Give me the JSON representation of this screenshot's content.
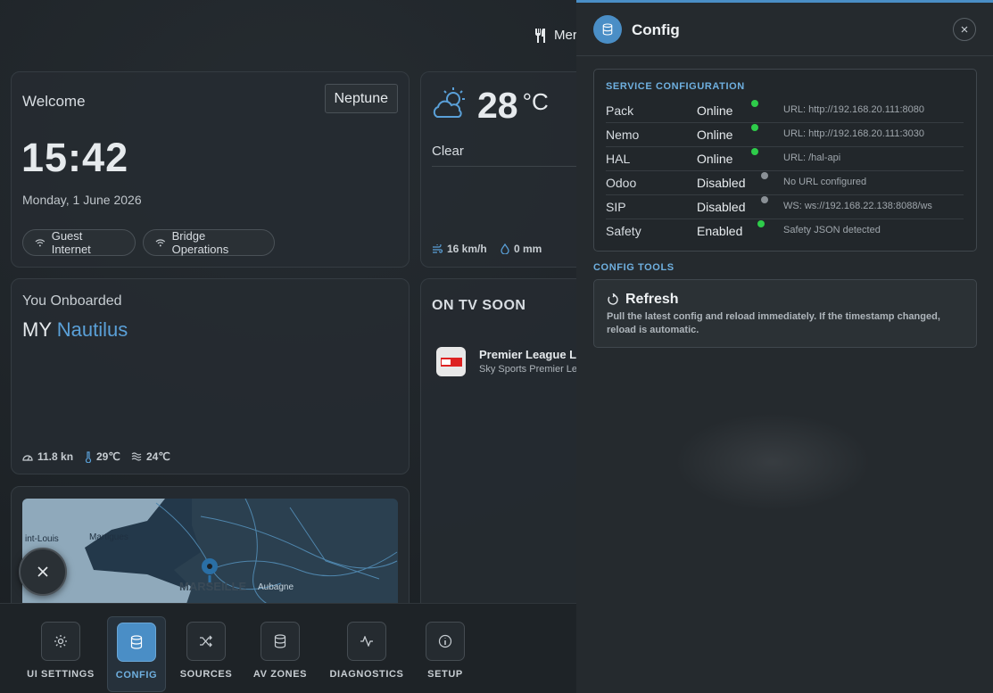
{
  "top": {
    "menu_label": "Mer"
  },
  "welcome": {
    "title": "Welcome",
    "location": "Neptune",
    "time": "15:42",
    "date": "Monday, 1 June 2026",
    "chips": [
      "Guest Internet",
      "Bridge Operations"
    ]
  },
  "weather": {
    "temp": "28",
    "unit": "°C",
    "condition": "Clear",
    "wind": "16 km/h",
    "rain": "0 mm"
  },
  "onboard": {
    "title": "You Onboarded",
    "prefix": "MY",
    "vessel": "Nautilus",
    "speed": "11.8 kn",
    "air_temp": "29℃",
    "water_temp": "24℃"
  },
  "tv": {
    "title": "ON TV SOON",
    "show": "Premier League Li",
    "channel": "Sky Sports Premier Lea"
  },
  "map": {
    "labels": [
      "int-Louis",
      "Martigues",
      "MARSEILLE",
      "Aubagne"
    ]
  },
  "nav": {
    "items": [
      "UI SETTINGS",
      "CONFIG",
      "SOURCES",
      "AV ZONES",
      "DIAGNOSTICS",
      "SETUP"
    ],
    "active": "CONFIG"
  },
  "panel": {
    "title": "Config",
    "service_heading": "SERVICE CONFIGURATION",
    "services": [
      {
        "name": "Pack",
        "status": "Online",
        "detail": "URL: http://192.168.20.111:8080",
        "dot": "#2ecc4a"
      },
      {
        "name": "Nemo",
        "status": "Online",
        "detail": "URL: http://192.168.20.111:3030",
        "dot": "#2ecc4a"
      },
      {
        "name": "HAL",
        "status": "Online",
        "detail": "URL: /hal-api",
        "dot": "#2ecc4a"
      },
      {
        "name": "Odoo",
        "status": "Disabled",
        "detail": "No URL configured",
        "dot": "#8a9096"
      },
      {
        "name": "SIP",
        "status": "Disabled",
        "detail": "WS: ws://192.168.22.138:8088/ws",
        "dot": "#8a9096"
      },
      {
        "name": "Safety",
        "status": "Enabled",
        "detail": "Safety JSON detected",
        "dot": "#2ecc4a"
      }
    ],
    "tools_heading": "CONFIG TOOLS",
    "refresh_title": "Refresh",
    "refresh_desc": "Pull the latest config and reload immediately. If the timestamp changed, reload is automatic."
  },
  "colors": {
    "accent": "#4a8ec6",
    "vessel": "#5aa0d8",
    "heading": "#6fb0e0",
    "online": "#2ecc4a",
    "disabled": "#8a9096"
  }
}
